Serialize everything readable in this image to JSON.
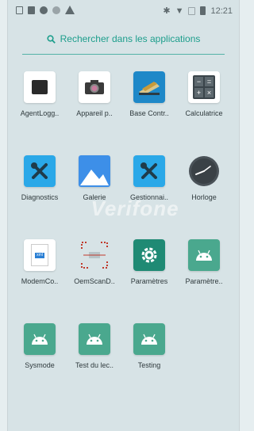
{
  "status_bar": {
    "time": "12:21"
  },
  "search": {
    "placeholder": "Rechercher dans les applications"
  },
  "watermark": "Verifone",
  "apps": [
    {
      "label": "AgentLogg..",
      "icon": "agentlog-icon"
    },
    {
      "label": "Appareil p..",
      "icon": "camera-icon"
    },
    {
      "label": "Base Contr..",
      "icon": "base-control-icon"
    },
    {
      "label": "Calculatrice",
      "icon": "calculator-icon"
    },
    {
      "label": "Diagnostics",
      "icon": "tools-icon"
    },
    {
      "label": "Galerie",
      "icon": "gallery-icon"
    },
    {
      "label": "Gestionnai..",
      "icon": "tools-icon"
    },
    {
      "label": "Horloge",
      "icon": "clock-icon"
    },
    {
      "label": "ModemCo..",
      "icon": "modem-icon"
    },
    {
      "label": "OemScanD..",
      "icon": "scan-icon"
    },
    {
      "label": "Paramètres",
      "icon": "gear-icon"
    },
    {
      "label": "Paramètre..",
      "icon": "android-icon"
    },
    {
      "label": "Sysmode",
      "icon": "android-icon"
    },
    {
      "label": "Test du lec..",
      "icon": "android-icon"
    },
    {
      "label": "Testing",
      "icon": "android-icon"
    }
  ],
  "colors": {
    "accent": "#1d9e8c",
    "background": "#d7e3e6"
  }
}
